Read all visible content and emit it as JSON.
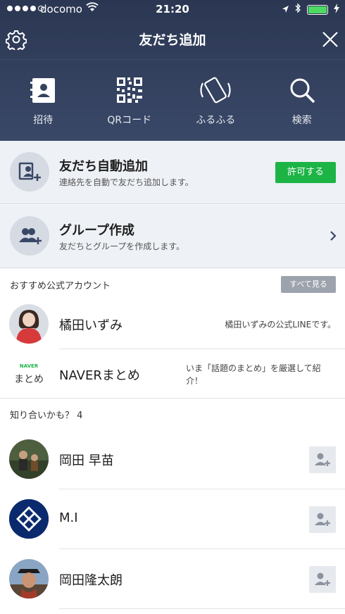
{
  "status_bar": {
    "carrier": "docomo",
    "time": "21:20",
    "signal_bars": 4,
    "battery_color": "#4cd964"
  },
  "header": {
    "title": "友だち追加",
    "settings_icon": "gear-icon",
    "close_icon": "close-icon",
    "bg_color": "#2f3b58"
  },
  "add_methods": [
    {
      "label": "招待",
      "icon": "contact-book-icon"
    },
    {
      "label": "QRコード",
      "icon": "qr-code-icon"
    },
    {
      "label": "ふるふる",
      "icon": "shake-phone-icon"
    },
    {
      "label": "検索",
      "icon": "search-icon"
    }
  ],
  "auto_add": {
    "title": "友だち自動追加",
    "subtitle": "連絡先を自動で友だち追加します。",
    "button": "許可する",
    "button_color": "#1db446"
  },
  "group": {
    "title": "グループ作成",
    "subtitle": "友だちとグループを作成します。"
  },
  "official": {
    "heading": "おすすめ公式アカウント",
    "see_all": "すべて見る",
    "accounts": [
      {
        "name": "橘田いずみ",
        "description": "橘田いずみの公式LINEです。"
      },
      {
        "name": "NAVERまとめ",
        "logo_top": "NAVER",
        "logo_bottom": "まとめ",
        "description": "いま「話題のまとめ」を厳選して紹介！"
      }
    ]
  },
  "suggestions": {
    "heading": "知り合いかも？ 4",
    "people": [
      {
        "name": "岡田 早苗"
      },
      {
        "name": "M.I"
      },
      {
        "name": "岡田隆太朗"
      }
    ]
  }
}
